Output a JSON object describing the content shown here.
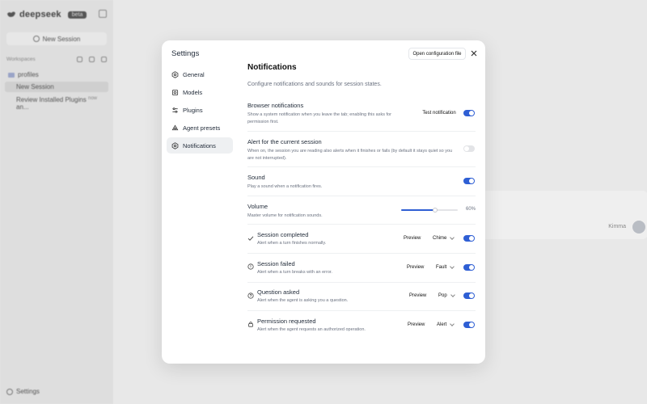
{
  "app": {
    "logo_text": "deepseek",
    "beta_badge": "beta",
    "new_session_label": "New Session",
    "workspaces_label": "Workspaces",
    "project_name": "profiles",
    "sessions": [
      {
        "title": "New Session",
        "time": ""
      },
      {
        "title": "Review Installed Plugins an...",
        "time": "now"
      }
    ],
    "settings_label": "Settings",
    "composer_model": "Kimma"
  },
  "modal": {
    "title": "Settings",
    "config_button": "Open configuration file",
    "nav": [
      {
        "label": "General",
        "icon": "hexagon-icon"
      },
      {
        "label": "Models",
        "icon": "models-icon"
      },
      {
        "label": "Plugins",
        "icon": "plugins-icon"
      },
      {
        "label": "Agent presets",
        "icon": "agent-presets-icon"
      },
      {
        "label": "Notifications",
        "icon": "hexagon-icon",
        "active": true
      }
    ],
    "page": {
      "title": "Notifications",
      "subtitle": "Configure notifications and sounds for session states.",
      "browser": {
        "title": "Browser notifications",
        "desc": "Show a system notification when you leave the tab; enabling this asks for permission first.",
        "button": "Test notification",
        "enabled": true
      },
      "current_session": {
        "title": "Alert for the current session",
        "desc": "When on, the session you are reading also alerts when it finishes or fails (by default it stays quiet so you are not interrupted).",
        "enabled": false
      },
      "sound": {
        "title": "Sound",
        "desc": "Play a sound when a notification fires.",
        "enabled": true
      },
      "volume": {
        "title": "Volume",
        "desc": "Master volume for notification sounds.",
        "value": 0.6,
        "label": "60%"
      },
      "events": [
        {
          "title": "Session completed",
          "desc": "Alert when a turn finishes normally.",
          "preview": "Preview",
          "sound": "Chime",
          "enabled": true,
          "icon": "check-icon"
        },
        {
          "title": "Session failed",
          "desc": "Alert when a turn breaks with an error.",
          "preview": "Preview",
          "sound": "Fault",
          "enabled": true,
          "icon": "alert-circle-icon"
        },
        {
          "title": "Question asked",
          "desc": "Alert when the agent is asking you a question.",
          "preview": "Preview",
          "sound": "Pop",
          "enabled": true,
          "icon": "question-icon"
        },
        {
          "title": "Permission requested",
          "desc": "Alert when the agent requests an authorized operation.",
          "preview": "Preview",
          "sound": "Alert",
          "enabled": true,
          "icon": "lock-icon"
        }
      ]
    }
  },
  "colors": {
    "accent": "#2f5fd4",
    "toggle_off": "#e3e4e7"
  }
}
